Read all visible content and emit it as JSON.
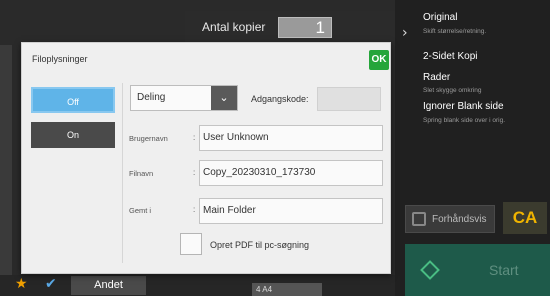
{
  "topbar": {
    "copies_label": "Antal kopier",
    "copies_value": "1"
  },
  "right_panel": {
    "items": [
      {
        "title": "Original",
        "subtitle": "Skift størrelse/retning."
      },
      {
        "title": "2-Sidet Kopi",
        "subtitle": ""
      },
      {
        "title": "Rader",
        "subtitle": "Slet skygge omkring"
      },
      {
        "title": "Ignorer Blank side",
        "subtitle": "Spring blank side over i orig."
      }
    ],
    "preview_label": "Forhåndsvis",
    "ca_label": "CA",
    "start_label": "Start"
  },
  "bottom": {
    "other_label": "Andet",
    "status_text": "4   A4"
  },
  "dialog": {
    "title": "Filoplysninger",
    "ok_label": "OK",
    "off_label": "Off",
    "on_label": "On",
    "mode_value": "Deling",
    "password_label": "Adgangskode:",
    "fields": [
      {
        "label": "Brugernavn",
        "value": "User Unknown"
      },
      {
        "label": "Filnavn",
        "value": "Copy_20230310_173730"
      },
      {
        "label": "Gemt i",
        "value": "Main Folder"
      }
    ],
    "pdf_label": "Opret PDF til pc-søgning"
  },
  "colors": {
    "ok_green": "#25a53a",
    "toggle_active": "#5fb4e8",
    "ca_yellow": "#f0b400",
    "start_green": "#1e5a4a"
  }
}
